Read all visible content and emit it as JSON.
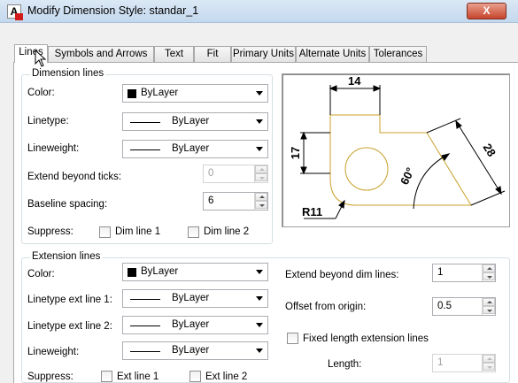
{
  "window": {
    "title": "Modify Dimension Style: standar_1",
    "close_glyph": "X",
    "app_icon_letter": "A"
  },
  "tabs": [
    {
      "label": "Lines",
      "active": true
    },
    {
      "label": "Symbols and Arrows"
    },
    {
      "label": "Text"
    },
    {
      "label": "Fit"
    },
    {
      "label": "Primary Units"
    },
    {
      "label": "Alternate Units"
    },
    {
      "label": "Tolerances"
    }
  ],
  "dimension_lines": {
    "group_label": "Dimension lines",
    "color_label": "Color:",
    "color_value": "ByLayer",
    "linetype_label": "Linetype:",
    "linetype_value": "ByLayer",
    "lineweight_label": "Lineweight:",
    "lineweight_value": "ByLayer",
    "extend_ticks_label": "Extend beyond ticks:",
    "extend_ticks_value": "0",
    "baseline_label": "Baseline spacing:",
    "baseline_value": "6",
    "suppress_label": "Suppress:",
    "dim_line1": "Dim line 1",
    "dim_line2": "Dim line 2"
  },
  "extension_lines": {
    "group_label": "Extension lines",
    "color_label": "Color:",
    "color_value": "ByLayer",
    "linetype1_label": "Linetype ext line 1:",
    "linetype1_value": "ByLayer",
    "linetype2_label": "Linetype ext line 2:",
    "linetype2_value": "ByLayer",
    "lineweight_label": "Lineweight:",
    "lineweight_value": "ByLayer",
    "suppress_label": "Suppress:",
    "ext_line1": "Ext line 1",
    "ext_line2": "Ext line 2",
    "extend_dim_label": "Extend beyond dim lines:",
    "extend_dim_value": "1",
    "offset_label": "Offset from origin:",
    "offset_value": "0.5",
    "fixed_length_label": "Fixed length extension lines",
    "length_label": "Length:",
    "length_value": "1"
  },
  "preview": {
    "dim_14": "14",
    "dim_17": "17",
    "dim_28": "28",
    "dim_60": "60°",
    "dim_r11": "R11"
  },
  "colors": {
    "geometry": "#c8a028",
    "close_button": "#c7442c",
    "group_border": "#d5dfe5"
  }
}
